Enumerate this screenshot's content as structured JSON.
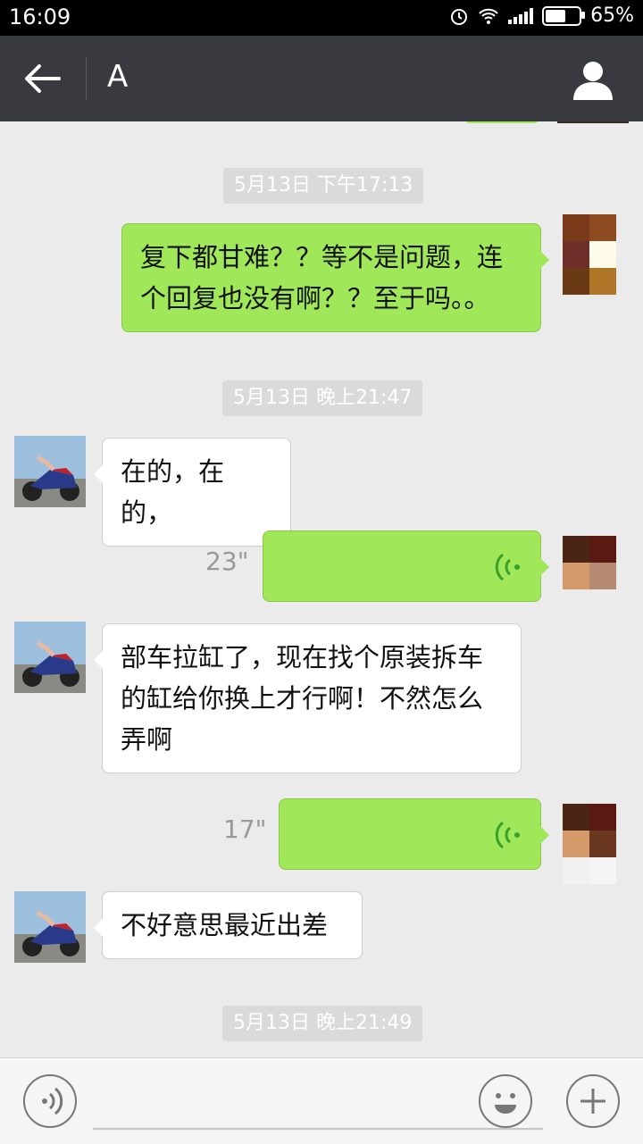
{
  "status": {
    "time": "16:09",
    "battery": "65%",
    "battery_level": 0.65
  },
  "header": {
    "back_icon": "arrow-left-icon",
    "title": "A",
    "profile_icon": "person-icon"
  },
  "timestamps": [
    "5月13日 下午17:13",
    "5月13日 晚上21:47",
    "5月13日 晚上21:49"
  ],
  "messages": [
    {
      "side": "out",
      "text": "复下都甘难？？等不是问题，连个回复也没有啊？？至于吗。。"
    },
    {
      "side": "in",
      "text": "在的，在的，"
    },
    {
      "side": "out",
      "type": "voice",
      "duration": "23\""
    },
    {
      "side": "in",
      "text": "部车拉缸了，现在找个原装拆车的缸给你换上才行啊！不然怎么弄啊"
    },
    {
      "side": "out",
      "type": "voice",
      "duration": "17\""
    },
    {
      "side": "in",
      "text": "不好意思最近出差"
    }
  ],
  "input": {
    "voice_icon": "voice-icon",
    "emoji_icon": "emoji-icon",
    "plus_icon": "plus-icon"
  },
  "colors": {
    "header": "#393a3f",
    "out_bubble": "#a0e75a",
    "in_bubble": "#ffffff",
    "chat_bg": "#ebebeb"
  }
}
